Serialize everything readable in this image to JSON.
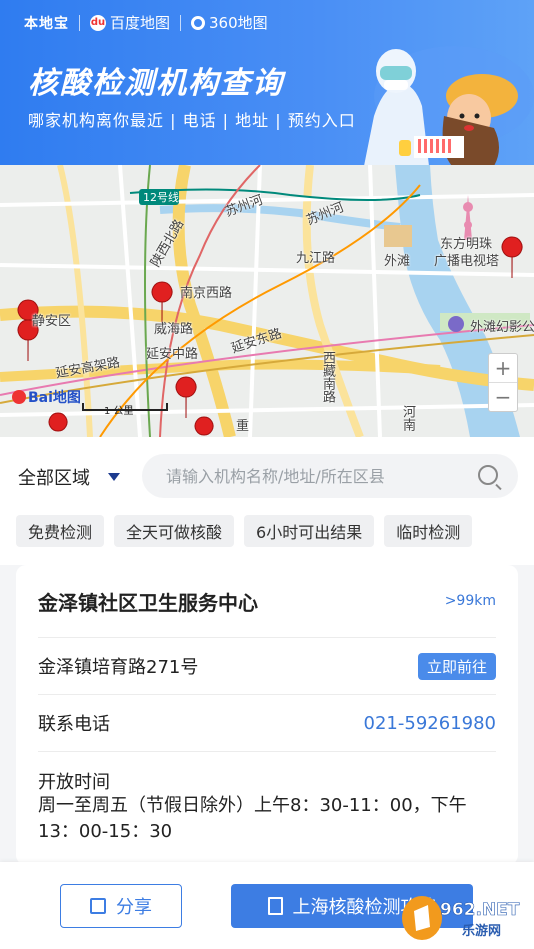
{
  "banner": {
    "brand_bendi": "本地宝",
    "brand_baidu": "百度地图",
    "brand_360": "360地图",
    "title": "核酸检测机构查询",
    "subtitle": "哪家机构离你最近 | 电话 | 地址 | 预约入口"
  },
  "map": {
    "labels": [
      "静安区",
      "延安高架路",
      "延安中路",
      "南京西路",
      "威海路",
      "延安东路",
      "九江路",
      "苏州河",
      "苏州河",
      "西藏南路",
      "外滩",
      "东方明珠",
      "广播电视塔",
      "外滩幻影公",
      "12号线",
      "陕西北路",
      "河南",
      "重"
    ],
    "zoom_in": "+",
    "zoom_out": "−",
    "logo_text": "Bai地图",
    "scale_text": "1 公里"
  },
  "filter": {
    "region": "全部区域",
    "search_placeholder": "请输入机构名称/地址/所在区县",
    "tags": [
      "免费检测",
      "全天可做核酸",
      "6小时可出结果",
      "临时检测"
    ]
  },
  "result": {
    "name": "金泽镇社区卫生服务中心",
    "distance": ">99km",
    "address": "金泽镇培育路271号",
    "go_label": "立即前往",
    "phone_label": "联系电话",
    "phone": "021-59261980",
    "hours_label": "开放时间",
    "hours": "周一至周五（节假日除外）上午8：30-11：00，下午13：00-15：30"
  },
  "bottom": {
    "share_label": "分享",
    "guide_label": "上海核酸检测攻略"
  },
  "watermark": {
    "text_top": "962.NET",
    "text_bottom": "乐游网"
  },
  "colors": {
    "banner": "#2f7cf0",
    "accent": "#3d7de3",
    "link": "#3a78d8"
  }
}
